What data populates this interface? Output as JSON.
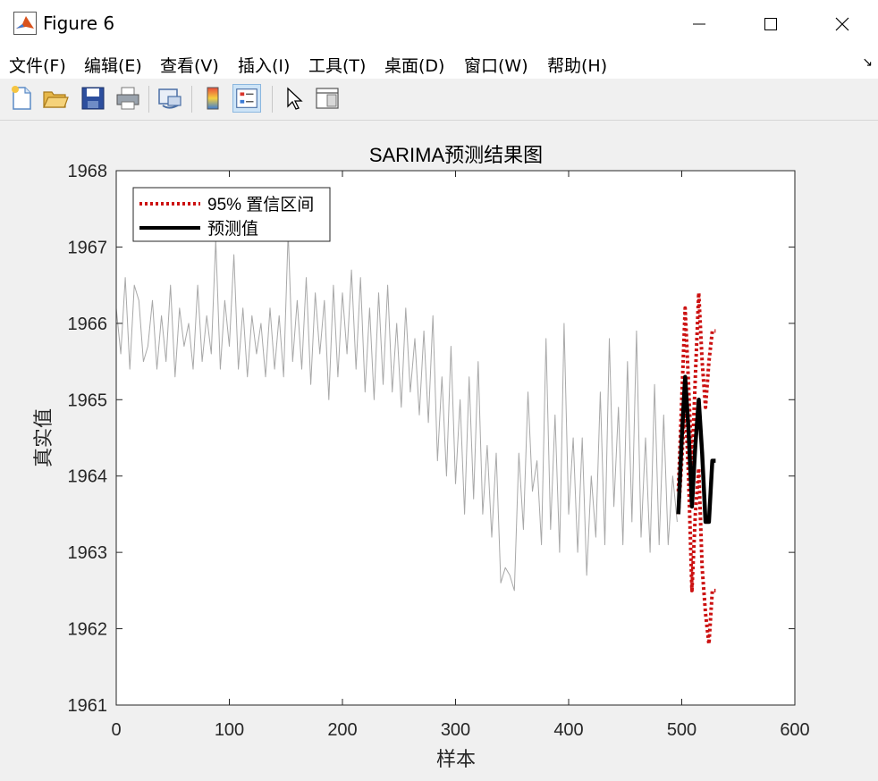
{
  "window": {
    "title": "Figure 6"
  },
  "menu": [
    "文件(F)",
    "编辑(E)",
    "查看(V)",
    "插入(I)",
    "工具(T)",
    "桌面(D)",
    "窗口(W)",
    "帮助(H)"
  ],
  "toolbar": {
    "icons": [
      "new-figure-icon",
      "open-file-icon",
      "save-icon",
      "print-icon",
      "link-plot-icon",
      "colorbar-icon",
      "legend-icon",
      "select-arrow-icon",
      "property-inspector-icon"
    ],
    "active": "legend-icon"
  },
  "chart_data": {
    "type": "line",
    "title": "SARIMA预测结果图",
    "xlabel": "样本",
    "ylabel": "真实值",
    "xlim": [
      0,
      600
    ],
    "ylim": [
      1961,
      1968
    ],
    "xticks": [
      0,
      100,
      200,
      300,
      400,
      500,
      600
    ],
    "yticks": [
      1961,
      1962,
      1963,
      1964,
      1965,
      1966,
      1967,
      1968
    ],
    "legend": {
      "position": "top-left",
      "entries": [
        {
          "label": "95% 置信区间",
          "color": "#cc1111",
          "style": "dotted"
        },
        {
          "label": "预测值",
          "color": "#000000",
          "style": "solid"
        }
      ]
    },
    "series": [
      {
        "role": "actual",
        "color": "#a8a8a8",
        "x": [
          0,
          4,
          8,
          12,
          16,
          20,
          24,
          28,
          32,
          36,
          40,
          44,
          48,
          52,
          56,
          60,
          64,
          68,
          72,
          76,
          80,
          84,
          88,
          92,
          96,
          100,
          104,
          108,
          112,
          116,
          120,
          124,
          128,
          132,
          136,
          140,
          144,
          148,
          152,
          156,
          160,
          164,
          168,
          172,
          176,
          180,
          184,
          188,
          192,
          196,
          200,
          204,
          208,
          212,
          216,
          220,
          224,
          228,
          232,
          236,
          240,
          244,
          248,
          252,
          256,
          260,
          264,
          268,
          272,
          276,
          280,
          284,
          288,
          292,
          296,
          300,
          304,
          308,
          312,
          316,
          320,
          324,
          328,
          332,
          336,
          340,
          344,
          348,
          352,
          356,
          360,
          364,
          368,
          372,
          376,
          380,
          384,
          388,
          392,
          396,
          400,
          404,
          408,
          412,
          416,
          420,
          424,
          428,
          432,
          436,
          440,
          444,
          448,
          452,
          456,
          460,
          464,
          468,
          472,
          476,
          480,
          484,
          488,
          492,
          496
        ],
        "y": [
          1966.2,
          1965.6,
          1966.6,
          1965.4,
          1966.5,
          1966.3,
          1965.5,
          1965.7,
          1966.3,
          1965.4,
          1966.1,
          1965.5,
          1966.5,
          1965.3,
          1966.2,
          1965.7,
          1966.0,
          1965.4,
          1966.5,
          1965.5,
          1966.1,
          1965.6,
          1967.1,
          1965.4,
          1966.3,
          1965.7,
          1966.9,
          1965.4,
          1966.2,
          1965.3,
          1966.1,
          1965.6,
          1966.0,
          1965.3,
          1966.2,
          1965.4,
          1966.1,
          1965.3,
          1967.2,
          1965.5,
          1966.3,
          1965.4,
          1966.6,
          1965.2,
          1966.4,
          1965.6,
          1966.3,
          1965.0,
          1966.5,
          1965.3,
          1966.4,
          1965.6,
          1966.7,
          1965.4,
          1966.6,
          1965.1,
          1966.2,
          1965.0,
          1966.4,
          1965.2,
          1966.5,
          1965.1,
          1966.0,
          1964.9,
          1966.2,
          1965.1,
          1965.8,
          1964.8,
          1965.9,
          1964.7,
          1966.1,
          1964.2,
          1965.3,
          1964.0,
          1965.7,
          1963.9,
          1965.0,
          1963.5,
          1965.3,
          1963.7,
          1965.5,
          1963.5,
          1964.4,
          1963.2,
          1964.3,
          1962.6,
          1962.8,
          1962.7,
          1962.5,
          1964.3,
          1963.3,
          1965.1,
          1963.8,
          1964.2,
          1963.1,
          1965.8,
          1963.3,
          1964.8,
          1963.0,
          1966.0,
          1963.5,
          1964.5,
          1963.0,
          1964.5,
          1962.7,
          1964.0,
          1963.2,
          1965.1,
          1963.1,
          1965.8,
          1963.6,
          1964.9,
          1963.1,
          1965.5,
          1963.4,
          1965.9,
          1963.2,
          1964.5,
          1963.0,
          1965.2,
          1963.1,
          1964.8,
          1963.1,
          1964.0,
          1963.4
        ]
      },
      {
        "role": "upper-bound",
        "color": "#cc1111",
        "x": [
          497,
          500,
          503,
          506,
          509,
          512,
          515,
          518,
          521,
          524,
          527,
          530
        ],
        "y": [
          1963.8,
          1965.0,
          1966.2,
          1965.2,
          1964.1,
          1965.3,
          1966.4,
          1965.5,
          1964.9,
          1965.5,
          1965.9,
          1965.9
        ]
      },
      {
        "role": "lower-bound",
        "color": "#cc1111",
        "x": [
          497,
          500,
          503,
          506,
          509,
          512,
          515,
          518,
          521,
          524,
          527,
          530
        ],
        "y": [
          1963.5,
          1964.2,
          1965.0,
          1964.0,
          1962.5,
          1963.5,
          1964.1,
          1962.8,
          1962.2,
          1961.8,
          1962.5,
          1962.5
        ]
      },
      {
        "role": "forecast",
        "color": "#000000",
        "x": [
          497,
          500,
          503,
          506,
          509,
          512,
          515,
          518,
          521,
          524,
          527,
          530
        ],
        "y": [
          1963.5,
          1964.5,
          1965.3,
          1964.6,
          1963.6,
          1964.4,
          1965.0,
          1964.3,
          1963.4,
          1963.4,
          1964.2,
          1964.2
        ]
      }
    ]
  }
}
